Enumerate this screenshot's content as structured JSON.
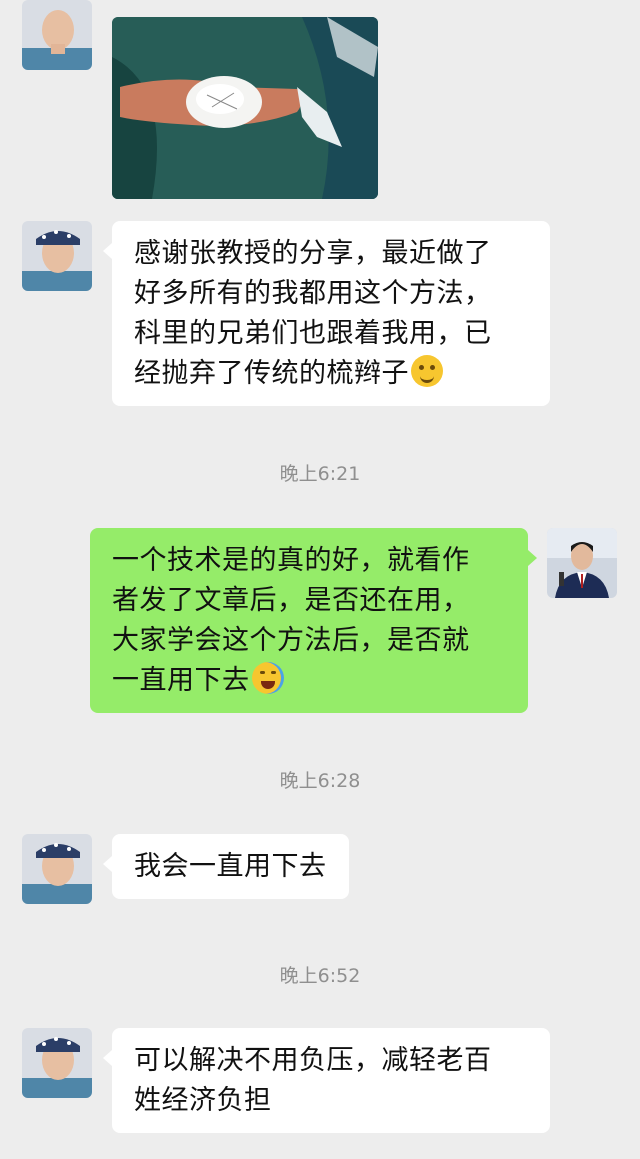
{
  "chat": {
    "messages": [
      {
        "side": "in",
        "type": "image",
        "image_desc": "surgical-photo"
      },
      {
        "side": "in",
        "type": "text",
        "lines": [
          "感谢张教授的分享，最近做了",
          "好多所有的我都用这个方法，",
          "科里的兄弟们也跟着我用，已",
          "经抛弃了传统的梳辫子"
        ],
        "emoji": "thinking-face"
      },
      {
        "time": "晚上6:21"
      },
      {
        "side": "out",
        "type": "text",
        "lines": [
          "一个技术是的真的好，就看作",
          "者发了文章后，是否还在用，",
          "大家学会这个方法后，是否就",
          "一直用下去"
        ],
        "emoji": "laughing-face"
      },
      {
        "time": "晚上6:28"
      },
      {
        "side": "in",
        "type": "text",
        "lines": [
          "我会一直用下去"
        ]
      },
      {
        "time": "晚上6:52"
      },
      {
        "side": "in",
        "type": "text",
        "lines": [
          "可以解决不用负压，减轻老百",
          "姓经济负担"
        ]
      }
    ]
  },
  "colors": {
    "background": "#ededed",
    "incoming_bubble": "#ffffff",
    "outgoing_bubble": "#95ec69",
    "timestamp": "#8f8f8f"
  }
}
